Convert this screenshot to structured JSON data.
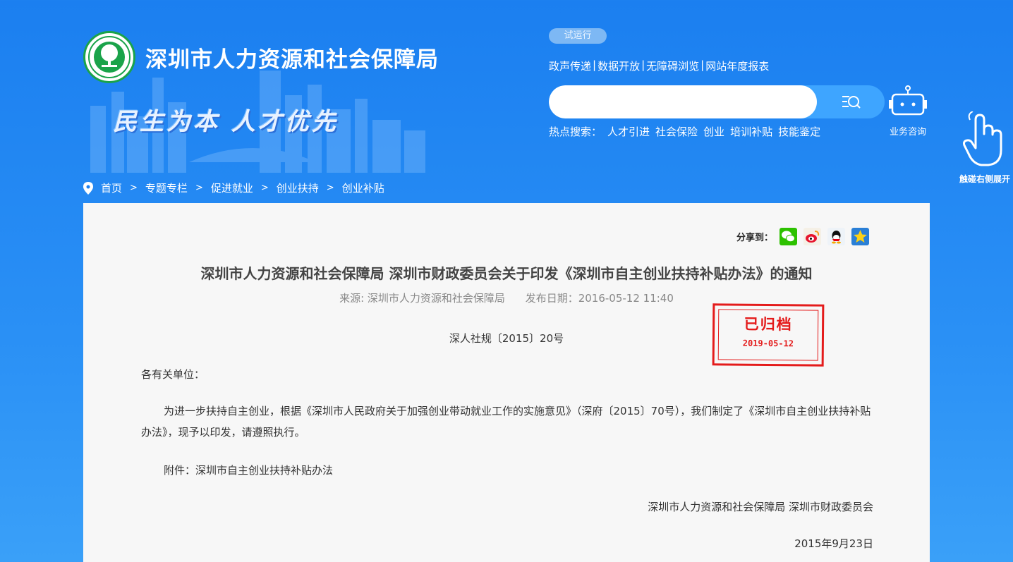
{
  "header": {
    "site_title": "深圳市人力资源和社会保障局",
    "slogan": "民生为本 人才优先",
    "trial_badge": "试运行",
    "top_links": [
      "政声传递",
      "数据开放",
      "无障碍浏览",
      "网站年度报表"
    ],
    "search": {
      "placeholder": ""
    },
    "hot_search_label": "热点搜索：",
    "hot_search_items": [
      "人才引进",
      "社会保险",
      "创业",
      "培训补贴",
      "技能鉴定"
    ],
    "consult_label": "业务咨询",
    "side_touch_label": "触碰右侧展开"
  },
  "breadcrumb": [
    "首页",
    "专题专栏",
    "促进就业",
    "创业扶持",
    "创业补贴"
  ],
  "breadcrumb_arrow": ">",
  "share": {
    "label": "分享到：",
    "icons": [
      "wechat-icon",
      "weibo-icon",
      "qq-icon",
      "qzone-icon"
    ]
  },
  "article": {
    "title": "深圳市人力资源和社会保障局 深圳市财政委员会关于印发《深圳市自主创业扶持补贴办法》的通知",
    "source": "来源: 深圳市人力资源和社会保障局",
    "publish_date": "发布日期：2016-05-12 11:40",
    "doc_number": "深人社规〔2015〕20号",
    "greeting": "各有关单位：",
    "paragraph": "为进一步扶持自主创业，根据《深圳市人民政府关于加强创业带动就业工作的实施意见》（深府〔2015〕70号），我们制定了《深圳市自主创业扶持补贴办法》，现予以印发，请遵照执行。",
    "attachment": "附件：深圳市自主创业扶持补贴办法",
    "signer": "深圳市人力资源和社会保障局 深圳市财政委员会",
    "sign_date": "2015年9月23日"
  },
  "stamp": {
    "title": "已归档",
    "date": "2019-05-12"
  },
  "colors": {
    "background": "#1b7ff0",
    "stamp": "#e41b1b",
    "logo_green": "#1aa34a"
  }
}
